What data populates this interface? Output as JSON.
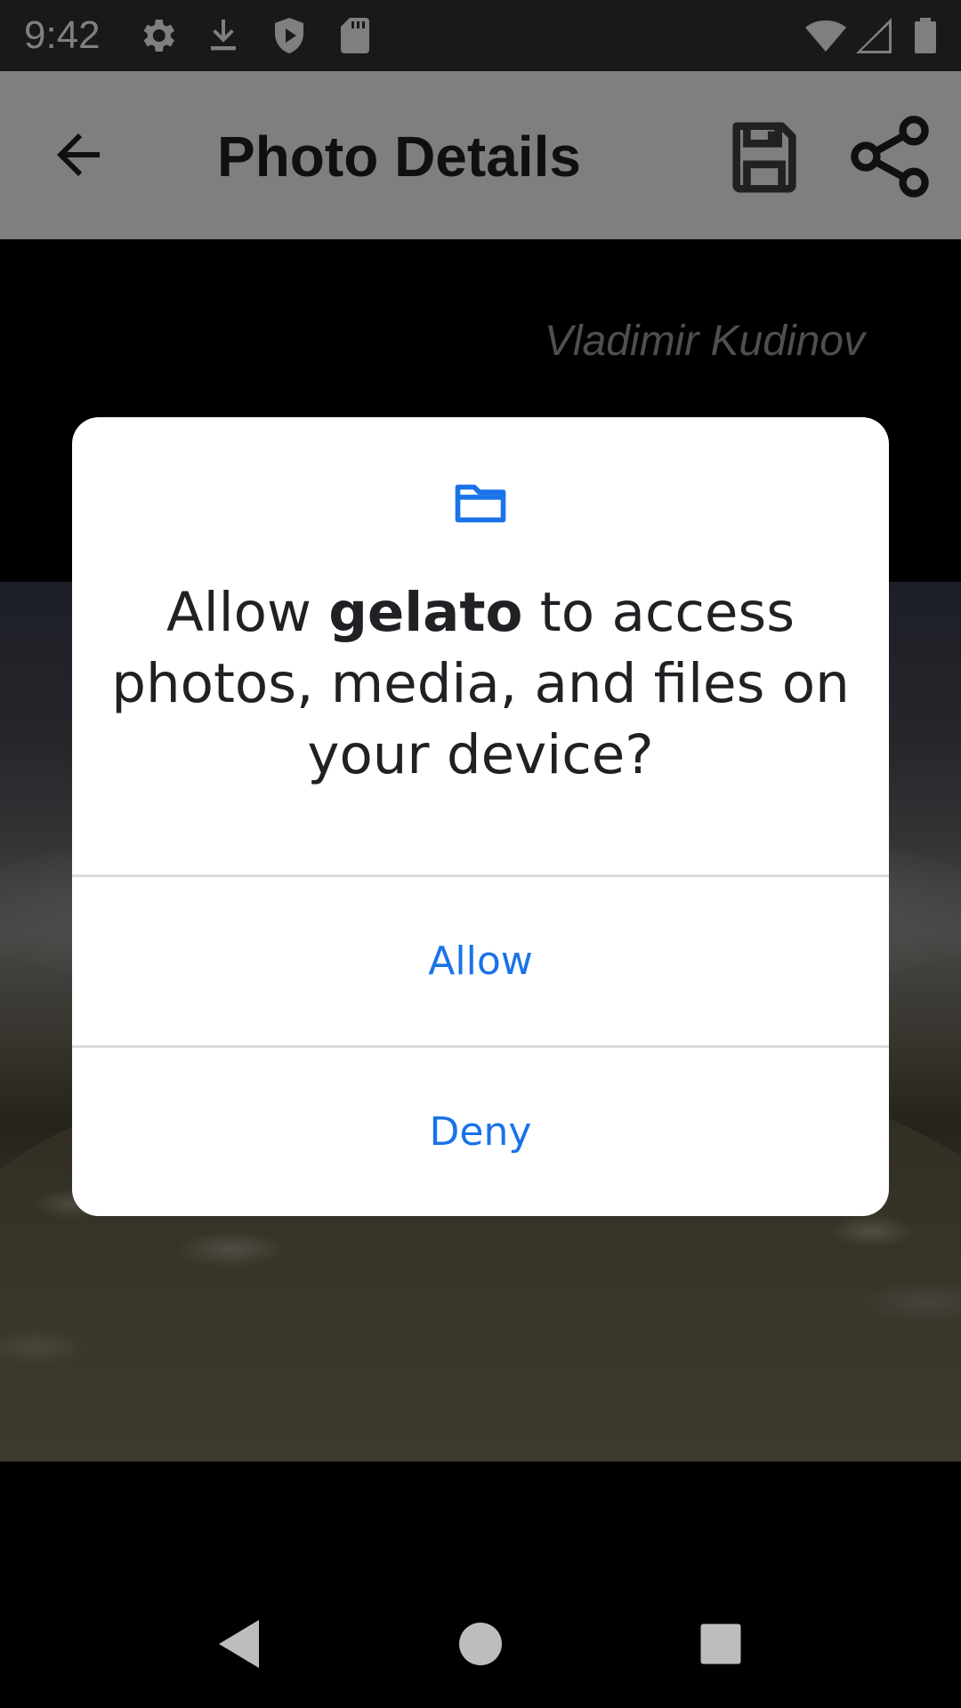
{
  "status_bar": {
    "time": "9:42",
    "icons": [
      "settings-icon",
      "download-icon",
      "shield-play-icon",
      "sd-card-icon"
    ],
    "right_icons": [
      "wifi-icon",
      "cellular-icon",
      "battery-icon"
    ]
  },
  "app_bar": {
    "title": "Photo Details",
    "back_icon": "arrow-back-icon",
    "actions": [
      "save-icon",
      "share-icon"
    ]
  },
  "content": {
    "photographer": "Vladimir Kudinov"
  },
  "dialog": {
    "icon": "folder-icon",
    "message_prefix": "Allow ",
    "app_name": "gelato",
    "message_suffix": " to access photos, media, and files on your device?",
    "allow_label": "Allow",
    "deny_label": "Deny",
    "accent_color": "#1a73e8"
  },
  "nav_bar": {
    "buttons": [
      "back-triangle-icon",
      "home-circle-icon",
      "recents-square-icon"
    ]
  }
}
